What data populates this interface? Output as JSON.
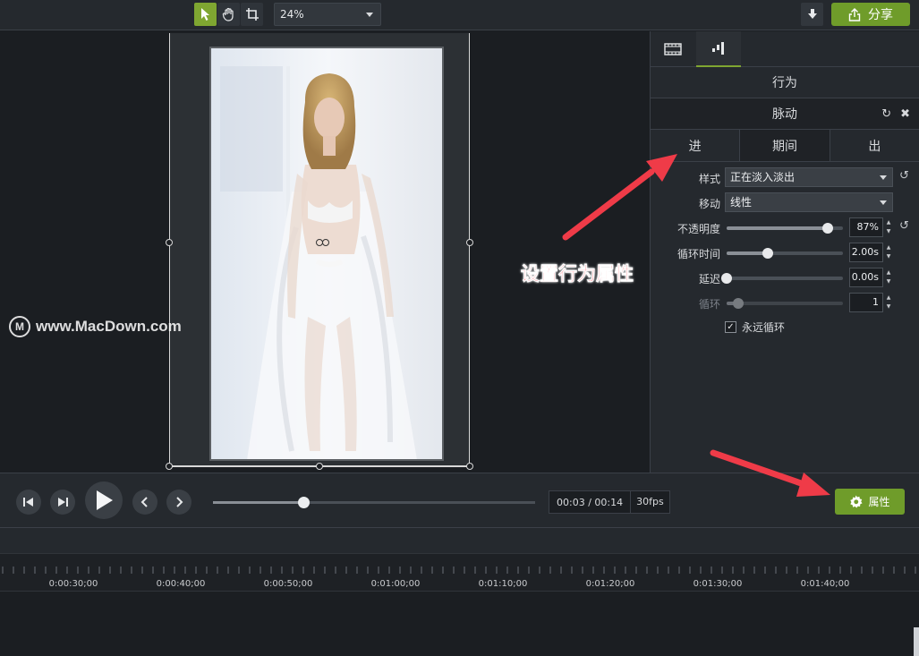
{
  "toolbar": {
    "zoom_value": "24%",
    "share_label": "分享"
  },
  "canvas": {
    "watermark_text": "www.MacDown.com"
  },
  "panel": {
    "section_title": "行为",
    "effect_name": "脉动",
    "phase_tabs": [
      "进",
      "期间",
      "出"
    ],
    "active_phase": "期间",
    "style_label": "样式",
    "style_value": "正在淡入淡出",
    "movement_label": "移动",
    "movement_value": "线性",
    "opacity_label": "不透明度",
    "opacity_value": "87%",
    "opacity_level": 0.87,
    "cycle_label": "循环时间",
    "cycle_value": "2.00s",
    "cycle_level": 0.35,
    "delay_label": "延迟",
    "delay_value": "0.00s",
    "delay_level": 0.0,
    "loop_label": "循环",
    "loop_value": "1",
    "loop_level": 0.1,
    "forever_label": "永远循环",
    "forever_checked": true
  },
  "annotation_text": "设置行为属性",
  "transport": {
    "time_display": "00:03 / 00:14",
    "fps": "30fps",
    "progress": 0.28,
    "properties_label": "属性"
  },
  "timeline": {
    "tick_labels": [
      "0:00:30;00",
      "0:00:40;00",
      "0:00:50;00",
      "0:01:00;00",
      "0:01:10;00",
      "0:01:20;00",
      "0:01:30;00",
      "0:01:40;00"
    ]
  }
}
